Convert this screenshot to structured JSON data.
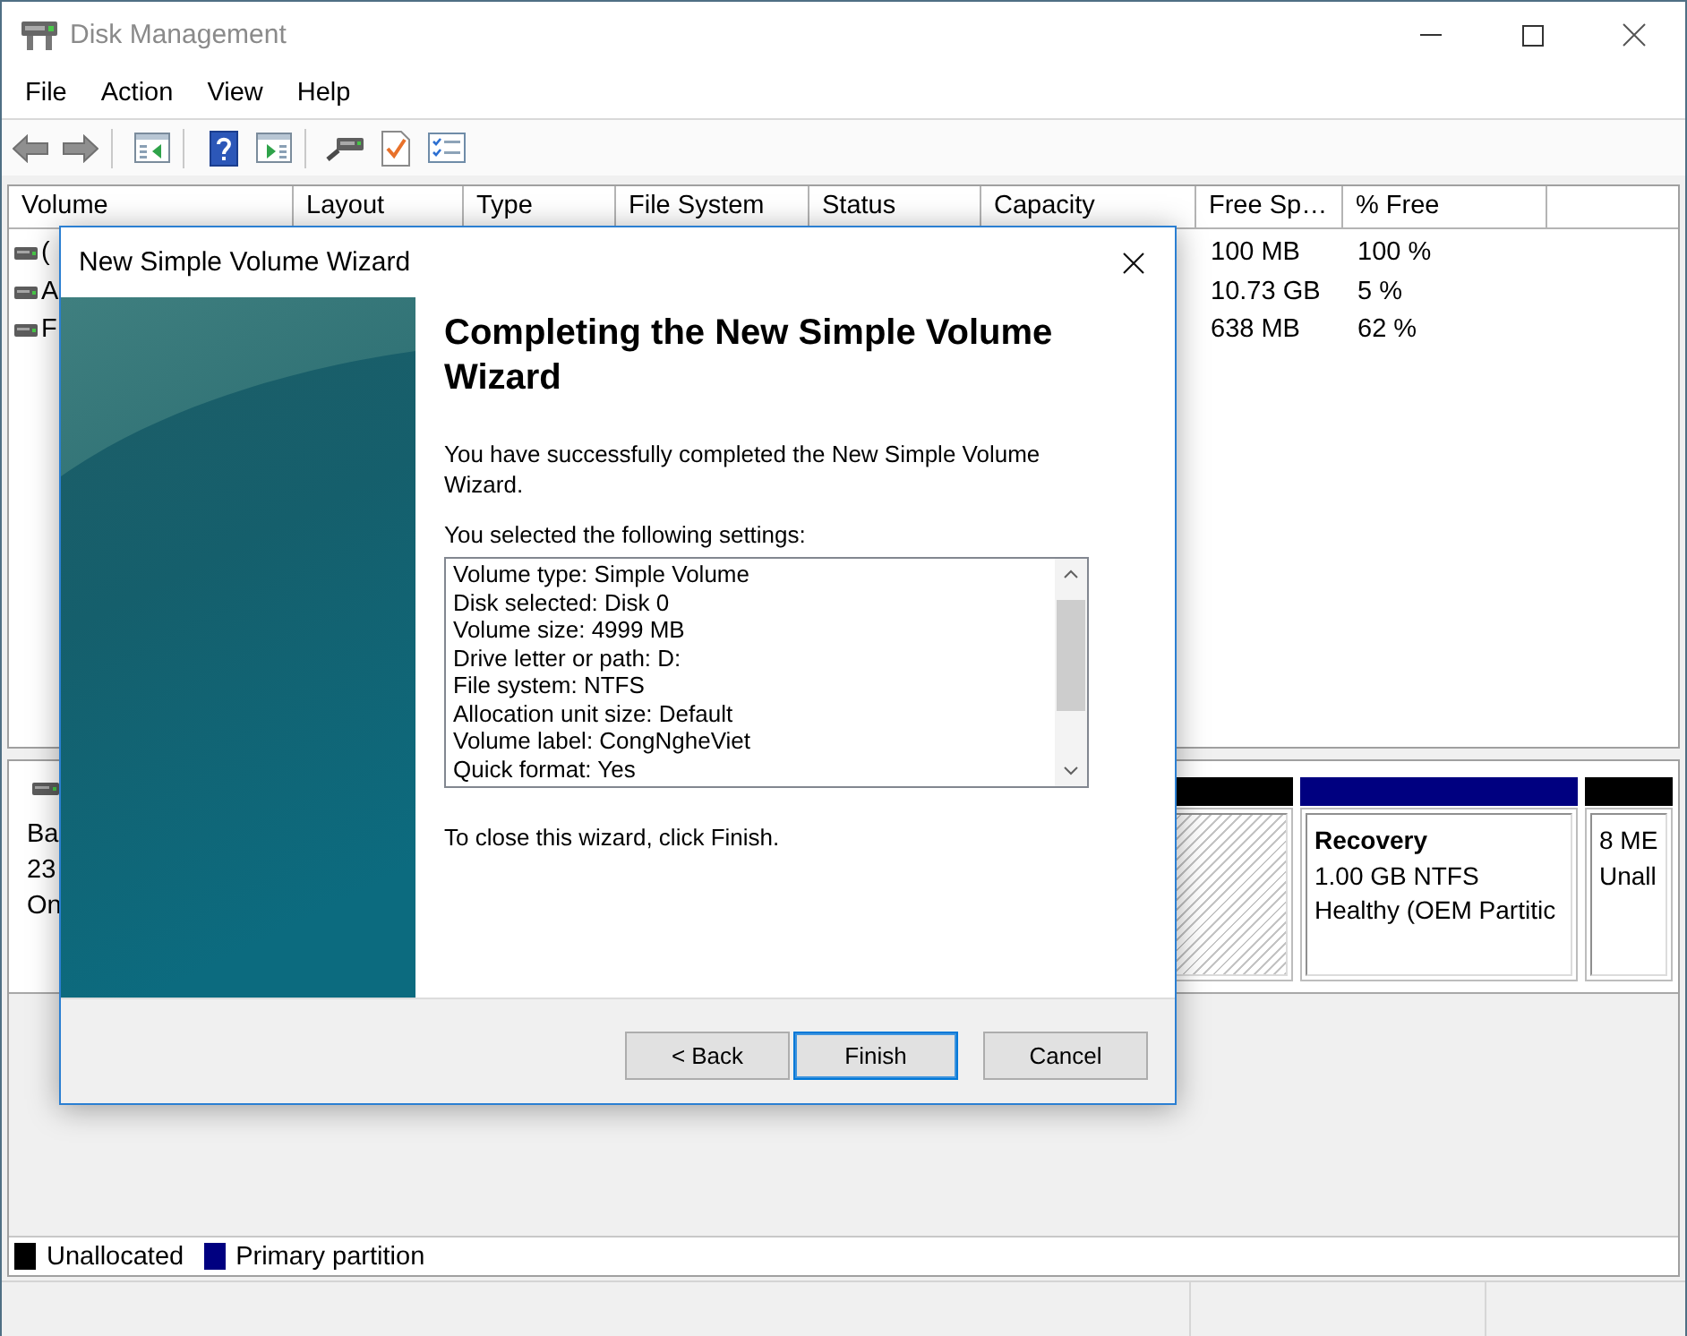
{
  "window": {
    "title": "Disk Management"
  },
  "menu": [
    "File",
    "Action",
    "View",
    "Help"
  ],
  "volume_list": {
    "columns": [
      "Volume",
      "Layout",
      "Type",
      "File System",
      "Status",
      "Capacity",
      "Free Sp…",
      "% Free"
    ],
    "rows": [
      {
        "volume": "(",
        "free_space": "100 MB",
        "percent_free": "100 %"
      },
      {
        "volume": "A",
        "free_space": "10.73 GB",
        "percent_free": "5 %"
      },
      {
        "volume": "F",
        "free_space": "638 MB",
        "percent_free": "62 %"
      }
    ]
  },
  "disk_map": {
    "disk_info": [
      "Ba",
      "23",
      "On"
    ],
    "partitions": [
      {
        "color": "#000000",
        "selected": true
      },
      {
        "color": "#000080",
        "selected": false,
        "name": "Recovery",
        "lines": [
          "1.00 GB NTFS",
          "Healthy (OEM Partitic"
        ]
      },
      {
        "color": "#000000",
        "selected": false,
        "lines": [
          "8 ME",
          "Unall"
        ]
      }
    ]
  },
  "legend": [
    {
      "label": "Unallocated",
      "color": "#000000"
    },
    {
      "label": "Primary partition",
      "color": "#000080"
    }
  ],
  "dialog": {
    "title": "New Simple Volume Wizard",
    "heading": "Completing the New Simple Volume Wizard",
    "intro": "You have successfully completed the New Simple Volume Wizard.",
    "settings_label": "You selected the following settings:",
    "settings": [
      "Volume type: Simple Volume",
      "Disk selected: Disk 0",
      "Volume size: 4999 MB",
      "Drive letter or path: D:",
      "File system: NTFS",
      "Allocation unit size: Default",
      "Volume label: CongNgheViet",
      "Quick format: Yes"
    ],
    "closing_note": "To close this wizard, click Finish.",
    "buttons": [
      {
        "label": "< Back",
        "default": false
      },
      {
        "label": "Finish",
        "default": true
      },
      {
        "label": "Cancel",
        "default": false
      }
    ]
  }
}
